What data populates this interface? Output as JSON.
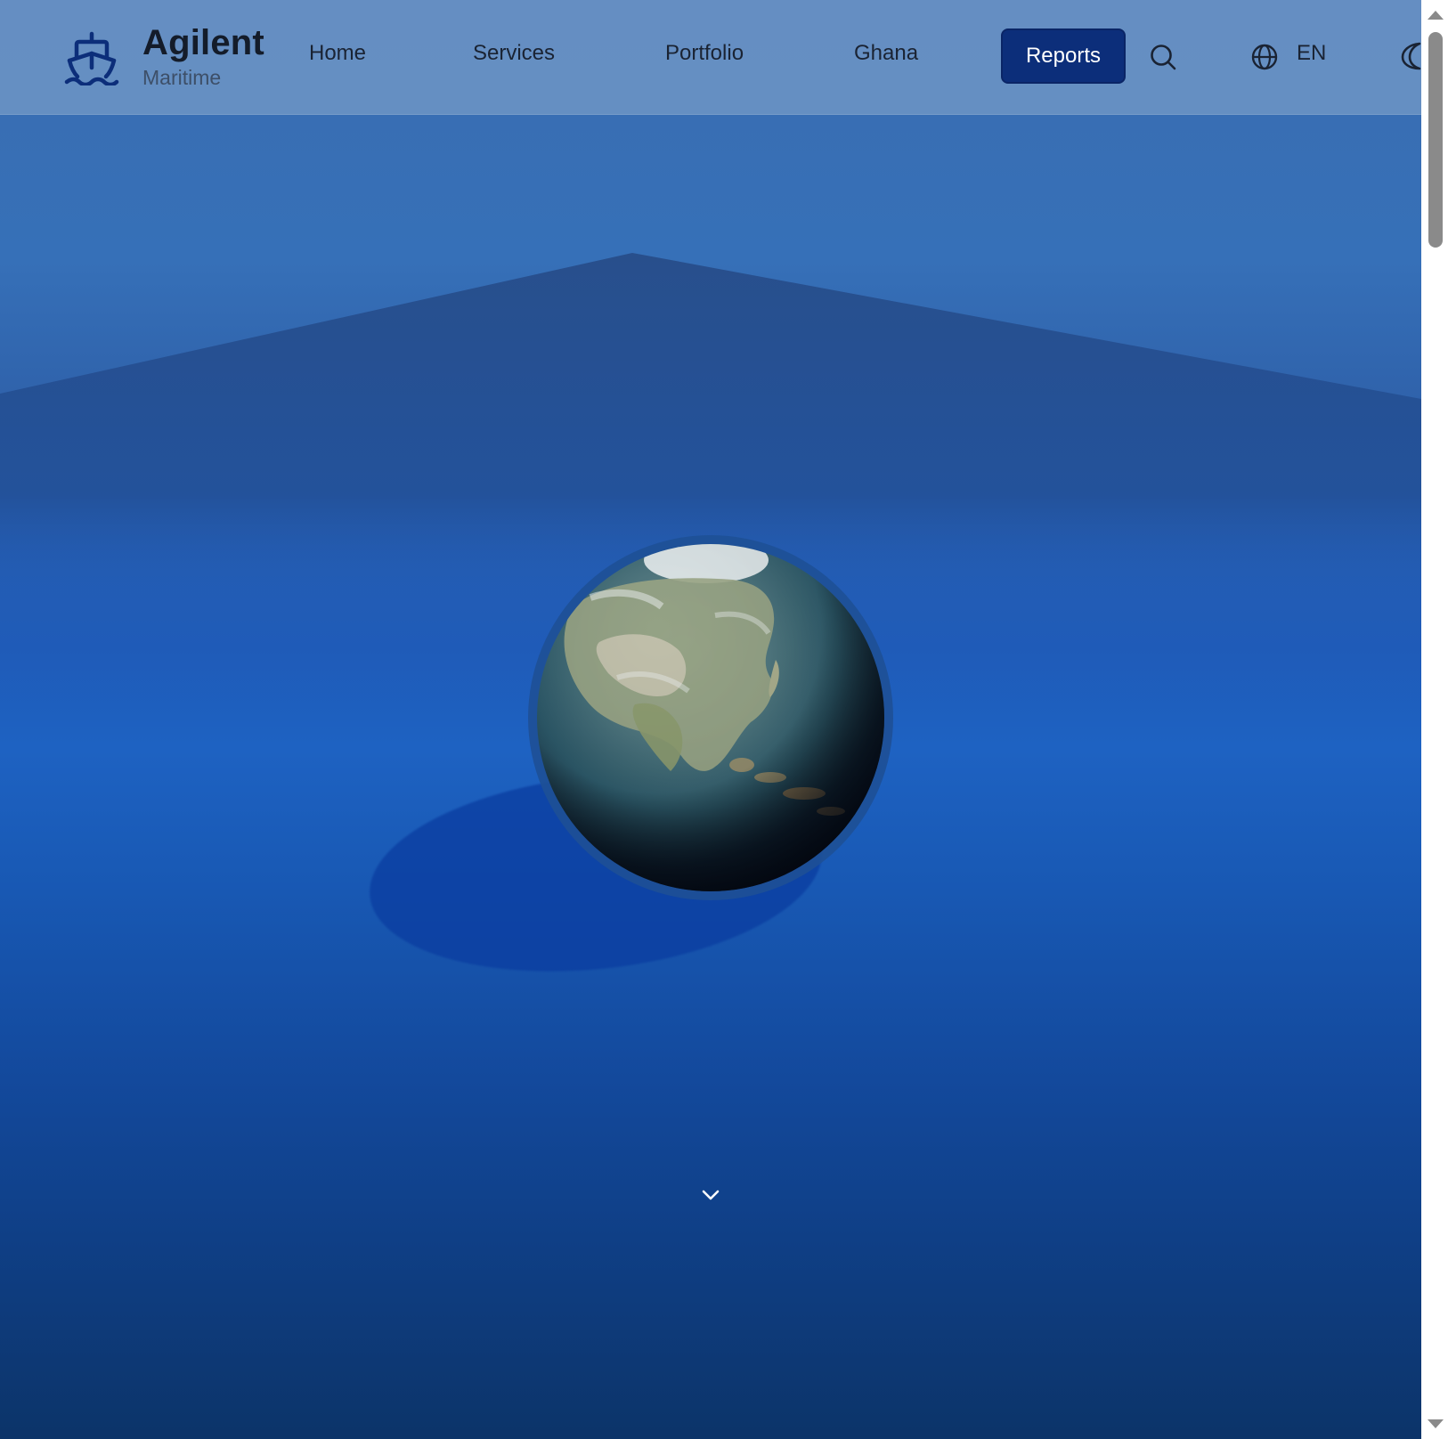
{
  "brand": {
    "name": "Agilent",
    "subtitle": "Maritime",
    "logo_icon": "ship-icon"
  },
  "nav": {
    "items": [
      {
        "label": "Home"
      },
      {
        "label": "Services"
      },
      {
        "label": "Portfolio"
      },
      {
        "label": "Ghana"
      }
    ],
    "reports_label": "Reports",
    "search_icon": "search-icon",
    "language_icon": "globe-icon",
    "language_label": "EN",
    "theme_icon": "moon-icon"
  },
  "hero": {
    "visual": "earth-globe",
    "scroll_icon": "chevron-down-icon"
  },
  "colors": {
    "primary": "#0c2e7a",
    "header_bg": "#6991c3",
    "hero_top": "#3a6db0",
    "hero_mid": "#1e62c2",
    "hero_bottom": "#0c3469"
  }
}
